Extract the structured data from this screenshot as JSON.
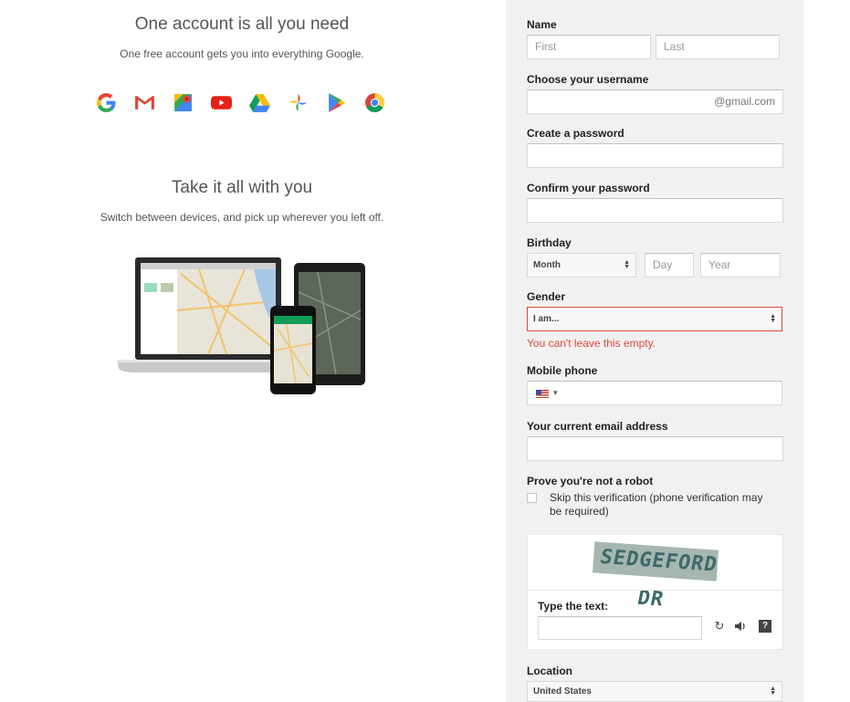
{
  "left": {
    "heading1": "One account is all you need",
    "sub1": "One free account gets you into everything Google.",
    "heading2": "Take it all with you",
    "sub2": "Switch between devices, and pick up wherever you left off.",
    "app_icons": [
      "google-g-icon",
      "gmail-icon",
      "maps-icon",
      "youtube-icon",
      "drive-icon",
      "photos-icon",
      "play-icon",
      "chrome-icon"
    ]
  },
  "form": {
    "name_label": "Name",
    "first_placeholder": "First",
    "last_placeholder": "Last",
    "username_label": "Choose your username",
    "username_suffix": "@gmail.com",
    "password_label": "Create a password",
    "confirm_label": "Confirm your password",
    "birthday_label": "Birthday",
    "month_value": "Month",
    "day_placeholder": "Day",
    "year_placeholder": "Year",
    "gender_label": "Gender",
    "gender_value": "I am...",
    "gender_error": "You can't leave this empty.",
    "phone_label": "Mobile phone",
    "phone_flag_caret": "▾",
    "email_label": "Your current email address",
    "robot_label": "Prove you're not a robot",
    "skip_text": "Skip this verification (phone verification may be required)",
    "captcha_word": "SEDGEFORD DR",
    "type_text_label": "Type the text:",
    "location_label": "Location",
    "location_value": "United States"
  },
  "colors": {
    "error": "#dd4b39",
    "panel": "#f1f1f1"
  }
}
